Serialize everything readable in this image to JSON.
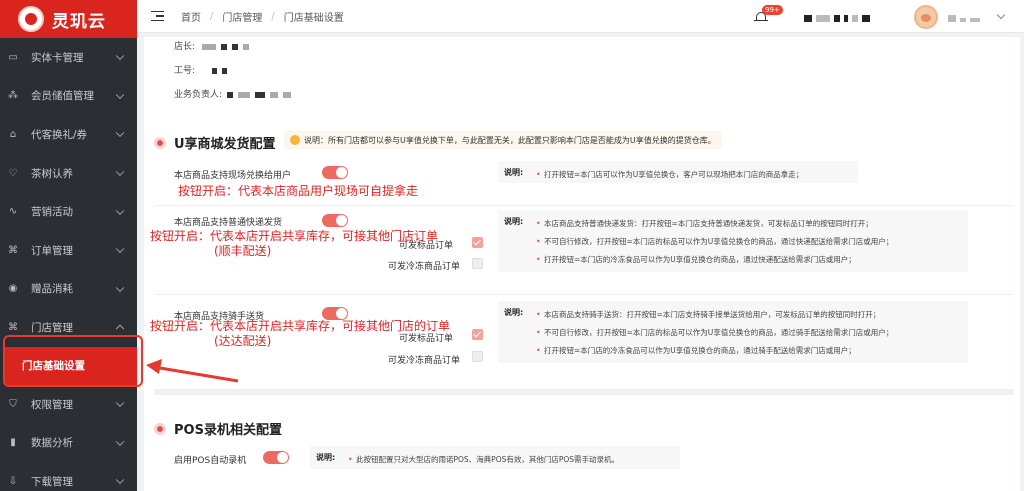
{
  "app": {
    "name": "灵玑云"
  },
  "sidebar": {
    "items": [
      {
        "label": "实体卡管理",
        "icon": "card-icon"
      },
      {
        "label": "会员储值管理",
        "icon": "members-icon"
      },
      {
        "label": "代客换礼/券",
        "icon": "gift-icon"
      },
      {
        "label": "茶树认养",
        "icon": "heart-icon"
      },
      {
        "label": "营销活动",
        "icon": "activity-icon"
      },
      {
        "label": "订单管理",
        "icon": "grid-icon"
      },
      {
        "label": "赠品消耗",
        "icon": "box-icon"
      },
      {
        "label": "门店管理",
        "icon": "grid-icon",
        "expanded": true
      },
      {
        "label": "权限管理",
        "icon": "shield-icon"
      },
      {
        "label": "数据分析",
        "icon": "chart-icon"
      },
      {
        "label": "下载管理",
        "icon": "download-icon"
      }
    ],
    "active_sub": "门店基础设置"
  },
  "header": {
    "breadcrumb": [
      "首页",
      "门店管理",
      "门店基础设置"
    ],
    "badge": "99+"
  },
  "content": {
    "top_fields": {
      "manager": "店长:",
      "employee_no": "工号:",
      "business_owner": "业务负责人:"
    },
    "u_section": {
      "title": "U享商城发货配置",
      "notice": "说明：所有门店都可以参与U享值兑换下单，与此配置无关，此配置只影响本门店是否能成为U享值兑换的提货仓库。",
      "pickup": {
        "label": "本店商品支持现场兑换给用户",
        "note_title": "说明:",
        "notes": [
          "打开按钮=本门店可以作为U享值兑换仓，客户可以现场把本门店的商品拿走；"
        ]
      },
      "express": {
        "label": "本店商品支持普通快递发货",
        "cb1": "可发标品订单",
        "cb2": "可发冷冻商品订单",
        "note_title": "说明:",
        "notes": [
          "本店商品支持普通快递发货：打开按钮=本门店支持普通快递发货，可发标品订单的按钮同时打开；",
          "不可自行修改，打开按钮=本门店的标品可以作为U享值兑换仓的商品，通过快递配送给需求门店或用户；",
          "打开按钮=本门店的冷冻食品可以作为U享值兑换仓的商品，通过快递配送给需求门店或用户；"
        ]
      },
      "rider": {
        "label": "本店商品支持骑手送货",
        "cb1": "可发标品订单",
        "cb2": "可发冷冻商品订单",
        "note_title": "说明:",
        "notes": [
          "本店商品支持骑手送货：打开按钮=本门店支持骑手接单送货给用户，可发标品订单的按钮同时打开；",
          "不可自行修改，打开按钮=本门店的标品可以作为U享值兑换仓的商品，通过骑手配送给需求门店或用户；",
          "打开按钮=本门店的冷冻食品可以作为U享值兑换仓的商品，通过骑手配送给需求门店或用户；"
        ]
      }
    },
    "pos_section": {
      "title": "POS录机相关配置",
      "label": "启用POS自动录机",
      "note_title": "说明:",
      "note": "此按钮配置只对大型店的雨诺POS、海典POS有效，其他门店POS需手动录机。"
    },
    "annotations": {
      "a1": "按钮开启：代表本店商品用户现场可自提拿走",
      "a2_line1": "按钮开启：代表本店开启共享库存，可接其他门店订单",
      "a2_line2": "(顺丰配送)",
      "a3_line1": "按钮开启：代表本店开启共享库存，可接其他门店的订单",
      "a3_line2": "(达达配送)"
    }
  },
  "colors": {
    "brand": "#d9251d",
    "toggle_on": "#ec6a5f",
    "annotation": "#e02424"
  }
}
